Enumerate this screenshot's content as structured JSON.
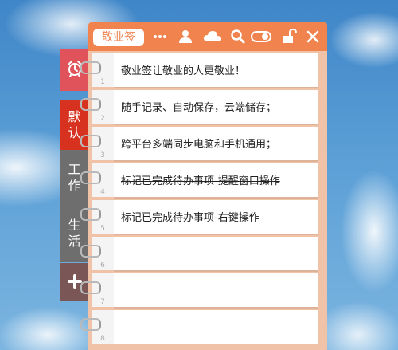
{
  "app": {
    "brand_label": "敬业签"
  },
  "sidebar": {
    "tabs": [
      {
        "label": "",
        "icon": "alarm-clock-icon"
      },
      {
        "label": "默\n认"
      },
      {
        "label": "工\n作"
      },
      {
        "label": "生\n活"
      },
      {
        "label": "+",
        "icon": "plus-icon"
      }
    ]
  },
  "header": {
    "icons": [
      "more-icon",
      "user-icon",
      "cloud-icon",
      "search-icon",
      "toggle-icon",
      "unlock-icon",
      "close-icon"
    ]
  },
  "notes": [
    {
      "num": "1",
      "text": "敬业签让敬业的人更敬业！",
      "done": false
    },
    {
      "num": "2",
      "text": "随手记录、自动保存，云端储存；",
      "done": false
    },
    {
      "num": "3",
      "text": "跨平台多端同步电脑和手机通用；",
      "done": false
    },
    {
      "num": "4",
      "text": "标记已完成待办事项-提醒窗口操作",
      "done": true
    },
    {
      "num": "5",
      "text": "标记已完成待办事项-右键操作",
      "done": true
    },
    {
      "num": "6",
      "text": "",
      "done": false
    },
    {
      "num": "7",
      "text": "",
      "done": false
    },
    {
      "num": "8",
      "text": "",
      "done": false
    }
  ],
  "colors": {
    "accent": "#f0834e",
    "panel": "#f0c2a7",
    "alarm_tab": "#e0535b",
    "active_tab": "#d6321f",
    "inactive_tab": "#6e6e6e"
  }
}
